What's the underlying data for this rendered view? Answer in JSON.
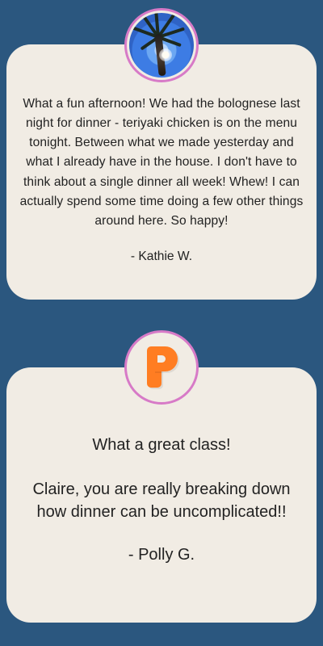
{
  "testimonials": [
    {
      "quote": "What a fun afternoon! We had the bolognese last night for dinner - teriyaki chicken is on the menu tonight. Between what we made yesterday and what I already have in the house. I don't have to think about a single dinner all week! Whew! I can actually spend some time doing a few other things around here. So happy!",
      "author": "- Kathie W.",
      "avatar": "palm-tree-photo"
    },
    {
      "title": "What a great class!",
      "quote": "Claire, you are really breaking down how dinner can be uncomplicated!!",
      "author": "- Polly G.",
      "avatar": "orange-p-logo"
    }
  ],
  "colors": {
    "background": "#2b577f",
    "card": "#f1ece4",
    "avatar_ring": "#d77ac7",
    "text": "#222222",
    "logo": "#ff7d22"
  }
}
